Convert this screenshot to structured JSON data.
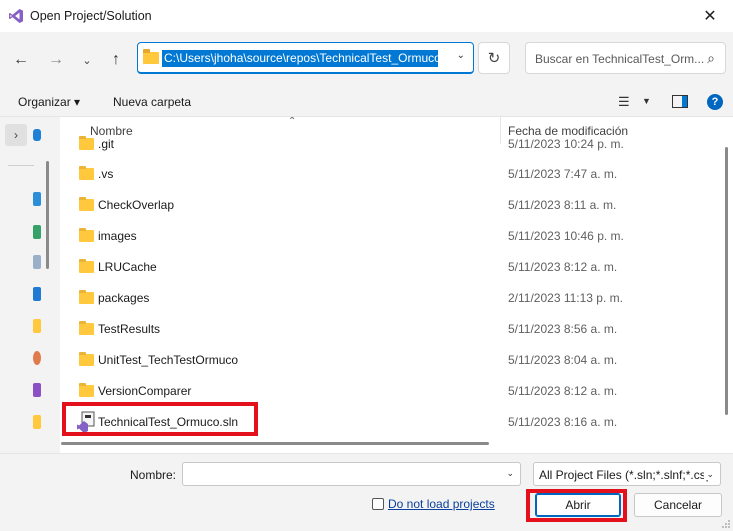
{
  "window": {
    "title": "Open Project/Solution",
    "close_glyph": "✕"
  },
  "navigation": {
    "back_glyph": "←",
    "forward_glyph": "→",
    "recent_glyph": "⌄",
    "up_glyph": "↑",
    "address_path": "C:\\Users\\jhoha\\source\\repos\\TechnicalTest_Ormuco",
    "address_drop_glyph": "⌄",
    "refresh_glyph": "↻",
    "search_placeholder": "Buscar en TechnicalTest_Orm...",
    "search_glyph": "⌕"
  },
  "toolbar": {
    "organize_label": "Organizar ▾",
    "new_folder_label": "Nueva carpeta",
    "view_glyph": "☰",
    "view_drop_glyph": "▼",
    "help_glyph": "?"
  },
  "sidebar": {
    "expand_glyph": "›"
  },
  "file_list": {
    "columns": {
      "name": "Nombre",
      "date": "Fecha de modificación",
      "sort_glyph": "⌃"
    },
    "rows": [
      {
        "name": ".git",
        "date": "5/11/2023 10:24 p. m.",
        "type": "folder"
      },
      {
        "name": ".vs",
        "date": "5/11/2023 7:47 a. m.",
        "type": "folder"
      },
      {
        "name": "CheckOverlap",
        "date": "5/11/2023 8:11 a. m.",
        "type": "folder"
      },
      {
        "name": "images",
        "date": "5/11/2023 10:46 p. m.",
        "type": "folder"
      },
      {
        "name": "LRUCache",
        "date": "5/11/2023 8:12 a. m.",
        "type": "folder"
      },
      {
        "name": "packages",
        "date": "2/11/2023 11:13 p. m.",
        "type": "folder"
      },
      {
        "name": "TestResults",
        "date": "5/11/2023 8:56 a. m.",
        "type": "folder"
      },
      {
        "name": "UnitTest_TechTestOrmuco",
        "date": "5/11/2023 8:04 a. m.",
        "type": "folder"
      },
      {
        "name": "VersionComparer",
        "date": "5/11/2023 8:12 a. m.",
        "type": "folder"
      },
      {
        "name": "TechnicalTest_Ormuco.sln",
        "date": "5/11/2023 8:16 a. m.",
        "type": "solution"
      }
    ]
  },
  "footer": {
    "filename_label": "Nombre:",
    "filename_value": "",
    "filetype_value": "All Project Files (*.sln;*.slnf;*.csp",
    "dropdown_glyph": "⌄",
    "do_not_load_label": "Do not load projects",
    "open_label": "Abrir",
    "cancel_label": "Cancelar"
  },
  "colors": {
    "accent": "#0078d4",
    "highlight_red": "#e4101c",
    "folder_yellow": "#ffc83d",
    "vs_purple": "#8661c5"
  }
}
